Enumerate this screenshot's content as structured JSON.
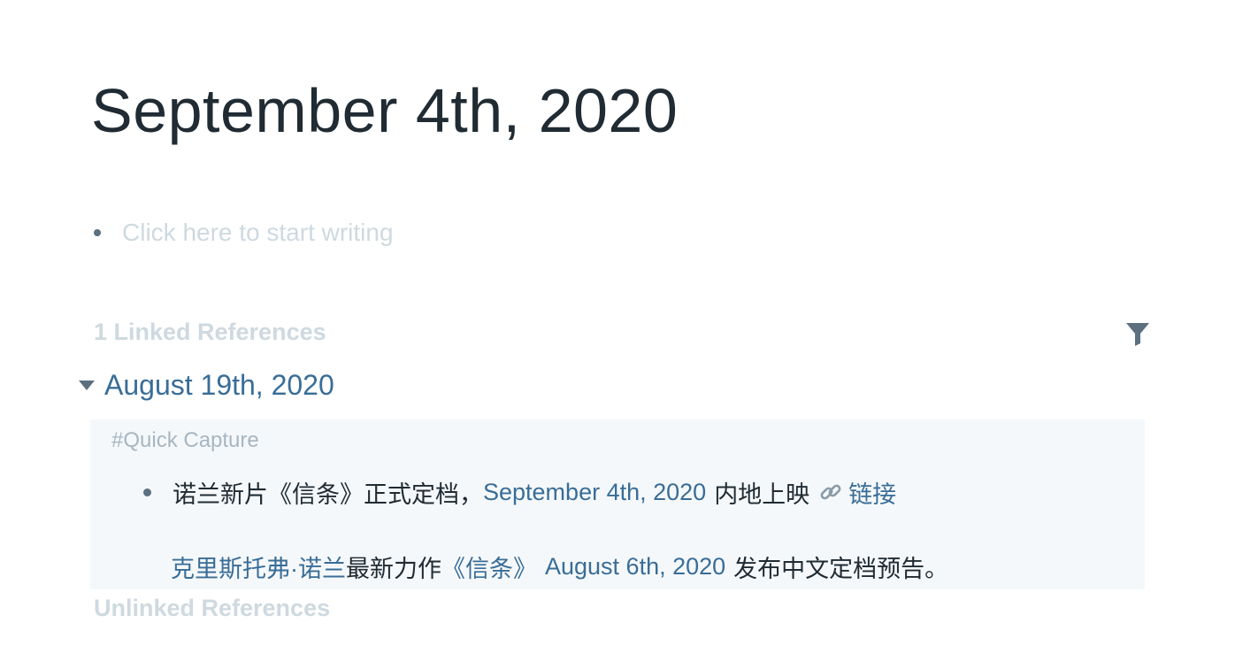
{
  "page": {
    "title": "September 4th, 2020"
  },
  "editor": {
    "placeholder": "Click here to start writing"
  },
  "linked_references": {
    "heading": "1 Linked References",
    "groups": [
      {
        "page_title": "August 19th, 2020",
        "breadcrumb": "#Quick Capture",
        "block": {
          "text_1": "诺兰新片《信条》正式定档，",
          "link_date": "September 4th, 2020",
          "text_2": "内地上映",
          "link_icon": "link-icon",
          "link_label": "链接",
          "line2_link_name": "克里斯托弗·诺兰",
          "line2_text_1": "最新力作",
          "line2_link_title": "《信条》",
          "line2_link_date": "August 6th, 2020",
          "line2_text_2": "发布中文定档预告。"
        }
      }
    ]
  },
  "unlinked_references": {
    "heading": "Unlinked References"
  },
  "icons": {
    "filter": "filter-icon",
    "caret": "caret-down-icon"
  },
  "colors": {
    "title": "#202b33",
    "link": "#396d97",
    "muted": "#ced9e0",
    "breadcrumb": "#a7b6c2",
    "block_bg": "#f5f8fa",
    "icon": "#5c7080"
  }
}
